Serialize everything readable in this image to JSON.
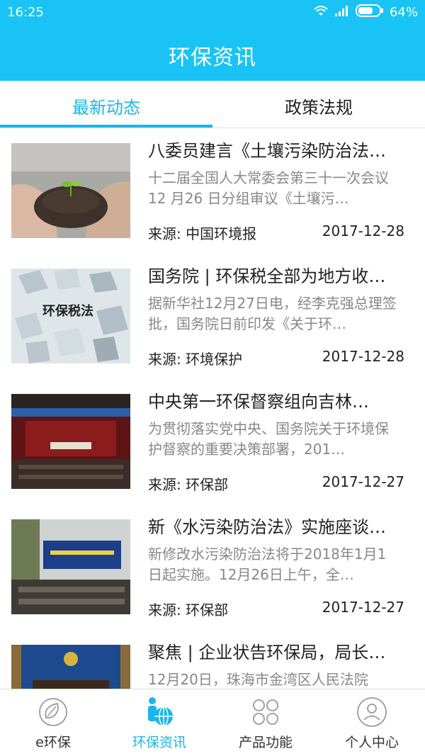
{
  "status_bar": {
    "time": "16:25",
    "battery": "64%"
  },
  "header": {
    "title": "环保资讯"
  },
  "tabs": [
    {
      "label": "最新动态",
      "active": true
    },
    {
      "label": "政策法规",
      "active": false
    }
  ],
  "news": [
    {
      "title": "八委员建言《土壤污染防治法…",
      "summary": "十二届全国人大常委会第三十一次会议12 月26 日分组审议《土壤污…",
      "source": "来源: 中国环境报",
      "date": "2017-12-28",
      "thumb_icon": "soil-sprout-image"
    },
    {
      "title": "国务院 | 环保税全部为地方收…",
      "summary": "据新华社12月27日电，经李克强总理签批，国务院日前印发《关于环…",
      "source": "来源: 环境保护",
      "date": "2017-12-28",
      "thumb_icon": "cubes-image",
      "thumb_text": "环保税法"
    },
    {
      "title": "中央第一环保督察组向吉林…",
      "summary": "为贯彻落实党中央、国务院关于环境保护督察的重要决策部署，201…",
      "source": "来源: 环保部",
      "date": "2017-12-27",
      "thumb_icon": "meeting-hall-image"
    },
    {
      "title": "新《水污染防治法》实施座谈…",
      "summary": "新修改水污染防治法将于2018年1月1日起实施。12月26日上午，全…",
      "source": "来源: 环保部",
      "date": "2017-12-27",
      "thumb_icon": "conference-room-image"
    },
    {
      "title": "聚焦 | 企业状告环保局，局长…",
      "summary": "12月20日，珠海市金湾区人民法院",
      "source": "",
      "date": "",
      "thumb_icon": "courtroom-image"
    }
  ],
  "bottom_nav": [
    {
      "label": "e环保",
      "icon": "leaf-globe-icon",
      "active": false
    },
    {
      "label": "环保资讯",
      "icon": "person-globe-icon",
      "active": true
    },
    {
      "label": "产品功能",
      "icon": "four-petal-icon",
      "active": false
    },
    {
      "label": "个人中心",
      "icon": "user-circle-icon",
      "active": false
    }
  ],
  "colors": {
    "primary": "#19c3f5",
    "active_text": "#19b6ec",
    "summary_text": "#888888"
  }
}
